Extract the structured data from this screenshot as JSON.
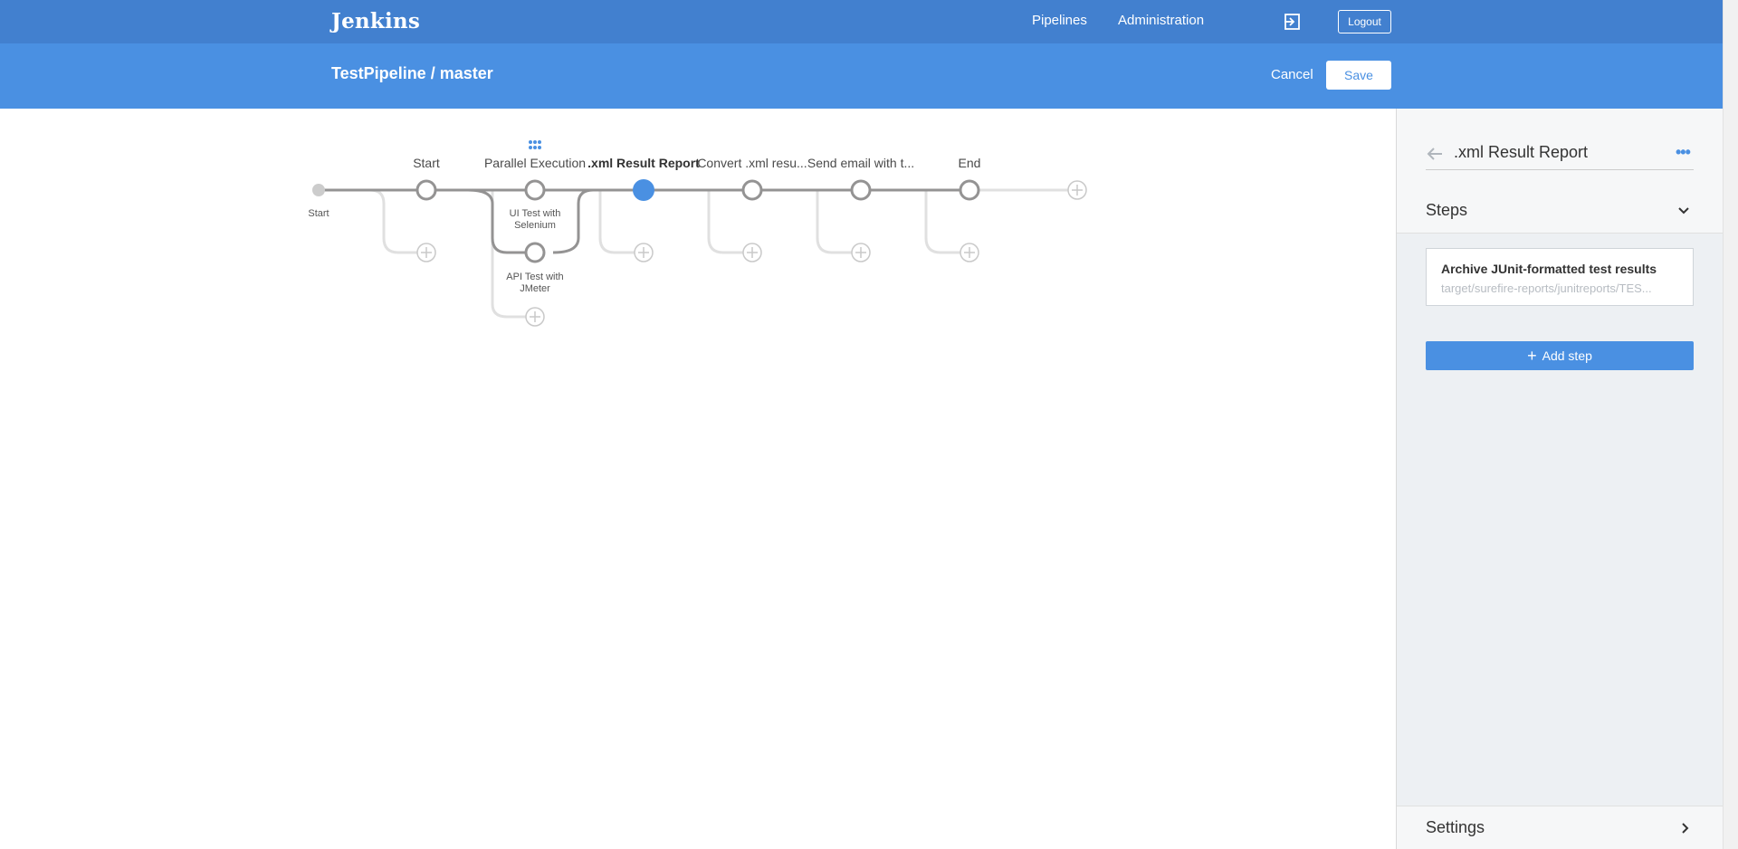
{
  "header": {
    "logo": "Jenkins",
    "nav": [
      {
        "label": "Pipelines"
      },
      {
        "label": "Administration"
      }
    ],
    "logout_label": "Logout",
    "signout_icon": "sign-out-icon"
  },
  "subheader": {
    "title": "TestPipeline / master",
    "cancel_label": "Cancel",
    "save_label": "Save"
  },
  "pipeline": {
    "start_label": "Start",
    "stages": [
      {
        "label": "Start"
      },
      {
        "label": "Parallel Execution",
        "parallel": [
          {
            "line1": "UI Test with",
            "line2": "Selenium"
          },
          {
            "line1": "API Test with",
            "line2": "JMeter"
          }
        ]
      },
      {
        "label": ".xml Result Report",
        "selected": true
      },
      {
        "label": "Convert .xml resu..."
      },
      {
        "label": "Send email with t..."
      },
      {
        "label": "End"
      }
    ],
    "colors": {
      "line": "#949393",
      "line_light": "#e0e0e0",
      "selected": "#4a90e2",
      "add": "#c9c9c9"
    }
  },
  "sidebar": {
    "title": ".xml Result Report",
    "more_label": "•••",
    "steps_label": "Steps",
    "steps": [
      {
        "title": "Archive JUnit-formatted test results",
        "subtitle": "target/surefire-reports/junitreports/TES..."
      }
    ],
    "add_step_label": "Add step",
    "add_step_icon": "+",
    "settings_label": "Settings"
  }
}
